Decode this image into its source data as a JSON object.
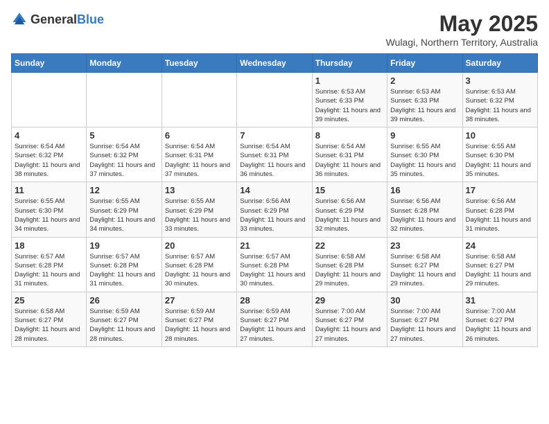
{
  "logo": {
    "text_general": "General",
    "text_blue": "Blue"
  },
  "title": "May 2025",
  "subtitle": "Wulagi, Northern Territory, Australia",
  "days_of_week": [
    "Sunday",
    "Monday",
    "Tuesday",
    "Wednesday",
    "Thursday",
    "Friday",
    "Saturday"
  ],
  "weeks": [
    [
      {
        "day": "",
        "info": ""
      },
      {
        "day": "",
        "info": ""
      },
      {
        "day": "",
        "info": ""
      },
      {
        "day": "",
        "info": ""
      },
      {
        "day": "1",
        "info": "Sunrise: 6:53 AM\nSunset: 6:33 PM\nDaylight: 11 hours and 39 minutes."
      },
      {
        "day": "2",
        "info": "Sunrise: 6:53 AM\nSunset: 6:33 PM\nDaylight: 11 hours and 39 minutes."
      },
      {
        "day": "3",
        "info": "Sunrise: 6:53 AM\nSunset: 6:32 PM\nDaylight: 11 hours and 38 minutes."
      }
    ],
    [
      {
        "day": "4",
        "info": "Sunrise: 6:54 AM\nSunset: 6:32 PM\nDaylight: 11 hours and 38 minutes."
      },
      {
        "day": "5",
        "info": "Sunrise: 6:54 AM\nSunset: 6:32 PM\nDaylight: 11 hours and 37 minutes."
      },
      {
        "day": "6",
        "info": "Sunrise: 6:54 AM\nSunset: 6:31 PM\nDaylight: 11 hours and 37 minutes."
      },
      {
        "day": "7",
        "info": "Sunrise: 6:54 AM\nSunset: 6:31 PM\nDaylight: 11 hours and 36 minutes."
      },
      {
        "day": "8",
        "info": "Sunrise: 6:54 AM\nSunset: 6:31 PM\nDaylight: 11 hours and 36 minutes."
      },
      {
        "day": "9",
        "info": "Sunrise: 6:55 AM\nSunset: 6:30 PM\nDaylight: 11 hours and 35 minutes."
      },
      {
        "day": "10",
        "info": "Sunrise: 6:55 AM\nSunset: 6:30 PM\nDaylight: 11 hours and 35 minutes."
      }
    ],
    [
      {
        "day": "11",
        "info": "Sunrise: 6:55 AM\nSunset: 6:30 PM\nDaylight: 11 hours and 34 minutes."
      },
      {
        "day": "12",
        "info": "Sunrise: 6:55 AM\nSunset: 6:29 PM\nDaylight: 11 hours and 34 minutes."
      },
      {
        "day": "13",
        "info": "Sunrise: 6:55 AM\nSunset: 6:29 PM\nDaylight: 11 hours and 33 minutes."
      },
      {
        "day": "14",
        "info": "Sunrise: 6:56 AM\nSunset: 6:29 PM\nDaylight: 11 hours and 33 minutes."
      },
      {
        "day": "15",
        "info": "Sunrise: 6:56 AM\nSunset: 6:29 PM\nDaylight: 11 hours and 32 minutes."
      },
      {
        "day": "16",
        "info": "Sunrise: 6:56 AM\nSunset: 6:28 PM\nDaylight: 11 hours and 32 minutes."
      },
      {
        "day": "17",
        "info": "Sunrise: 6:56 AM\nSunset: 6:28 PM\nDaylight: 11 hours and 31 minutes."
      }
    ],
    [
      {
        "day": "18",
        "info": "Sunrise: 6:57 AM\nSunset: 6:28 PM\nDaylight: 11 hours and 31 minutes."
      },
      {
        "day": "19",
        "info": "Sunrise: 6:57 AM\nSunset: 6:28 PM\nDaylight: 11 hours and 31 minutes."
      },
      {
        "day": "20",
        "info": "Sunrise: 6:57 AM\nSunset: 6:28 PM\nDaylight: 11 hours and 30 minutes."
      },
      {
        "day": "21",
        "info": "Sunrise: 6:57 AM\nSunset: 6:28 PM\nDaylight: 11 hours and 30 minutes."
      },
      {
        "day": "22",
        "info": "Sunrise: 6:58 AM\nSunset: 6:28 PM\nDaylight: 11 hours and 29 minutes."
      },
      {
        "day": "23",
        "info": "Sunrise: 6:58 AM\nSunset: 6:27 PM\nDaylight: 11 hours and 29 minutes."
      },
      {
        "day": "24",
        "info": "Sunrise: 6:58 AM\nSunset: 6:27 PM\nDaylight: 11 hours and 29 minutes."
      }
    ],
    [
      {
        "day": "25",
        "info": "Sunrise: 6:58 AM\nSunset: 6:27 PM\nDaylight: 11 hours and 28 minutes."
      },
      {
        "day": "26",
        "info": "Sunrise: 6:59 AM\nSunset: 6:27 PM\nDaylight: 11 hours and 28 minutes."
      },
      {
        "day": "27",
        "info": "Sunrise: 6:59 AM\nSunset: 6:27 PM\nDaylight: 11 hours and 28 minutes."
      },
      {
        "day": "28",
        "info": "Sunrise: 6:59 AM\nSunset: 6:27 PM\nDaylight: 11 hours and 27 minutes."
      },
      {
        "day": "29",
        "info": "Sunrise: 7:00 AM\nSunset: 6:27 PM\nDaylight: 11 hours and 27 minutes."
      },
      {
        "day": "30",
        "info": "Sunrise: 7:00 AM\nSunset: 6:27 PM\nDaylight: 11 hours and 27 minutes."
      },
      {
        "day": "31",
        "info": "Sunrise: 7:00 AM\nSunset: 6:27 PM\nDaylight: 11 hours and 26 minutes."
      }
    ]
  ]
}
